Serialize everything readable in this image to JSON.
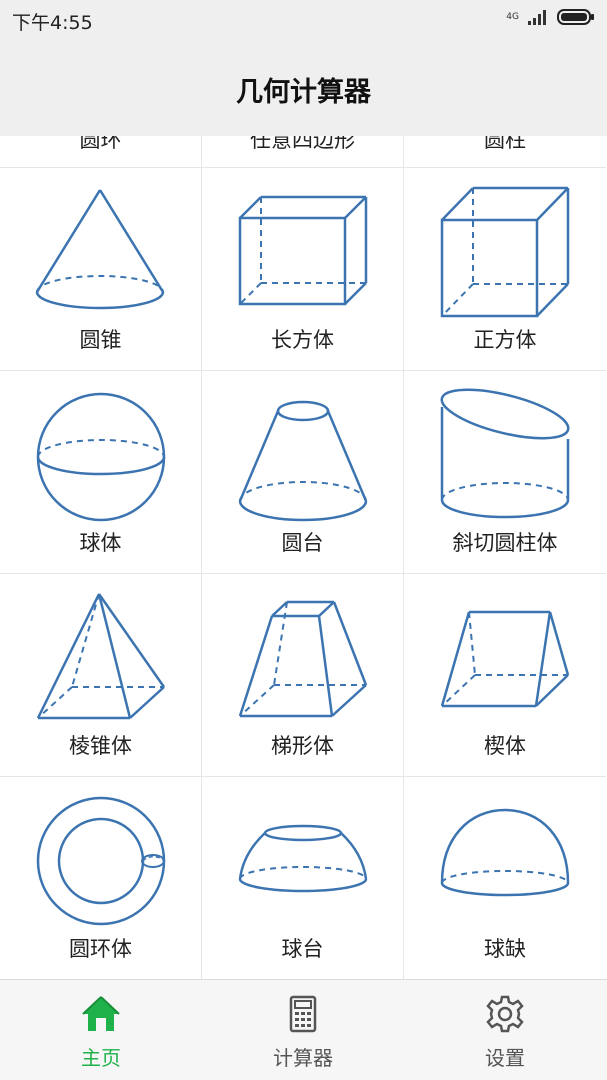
{
  "status_bar": {
    "time": "下午4:55",
    "network": "4G"
  },
  "header": {
    "title": "几何计算器"
  },
  "shapes": {
    "top_row": [
      "圆环",
      "任意四边形",
      "圆柱"
    ],
    "rows": [
      [
        "圆锥",
        "长方体",
        "正方体"
      ],
      [
        "球体",
        "圆台",
        "斜切圆柱体"
      ],
      [
        "棱锥体",
        "梯形体",
        "楔体"
      ],
      [
        "圆环体",
        "球台",
        "球缺"
      ]
    ]
  },
  "nav": {
    "home": "主页",
    "calculator": "计算器",
    "settings": "设置"
  },
  "colors": {
    "accent": "#20b24a",
    "shape_stroke": "#3b74b0"
  }
}
